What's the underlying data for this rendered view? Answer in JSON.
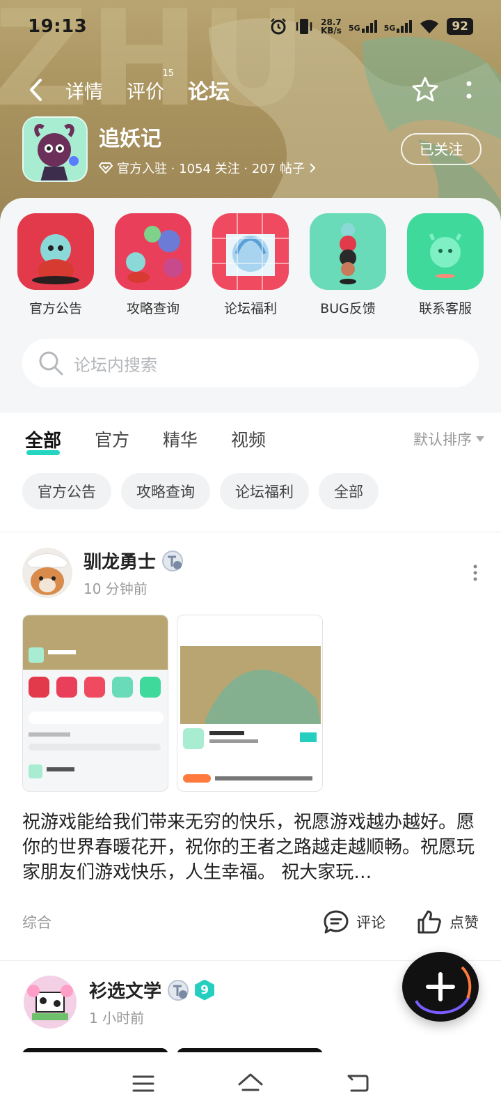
{
  "status_bar": {
    "time": "19:13",
    "speed_value": "28.7",
    "speed_unit": "KB/s",
    "network1": "5G",
    "network2": "5G",
    "battery": "92"
  },
  "nav": {
    "tabs": [
      {
        "label": "详情"
      },
      {
        "label": "评价",
        "badge": "15"
      },
      {
        "label": "论坛"
      }
    ],
    "active_tab": "论坛"
  },
  "game": {
    "name": "追妖记",
    "meta": "官方入驻 · 1054 关注 · 207 帖子",
    "follow_label": "已关注"
  },
  "shortcuts": [
    {
      "label": "官方公告",
      "color": "#e23a4b"
    },
    {
      "label": "攻略查询",
      "color": "#ea3f5a"
    },
    {
      "label": "论坛福利",
      "color": "#ef4a60"
    },
    {
      "label": "BUG反馈",
      "color": "#5fd7b6"
    },
    {
      "label": "联系客服",
      "color": "#3fd99b"
    }
  ],
  "search": {
    "placeholder": "论坛内搜索"
  },
  "filters": {
    "tabs": [
      "全部",
      "官方",
      "精华",
      "视频"
    ],
    "active": "全部",
    "sort_label": "默认排序"
  },
  "chips": [
    "官方公告",
    "攻略查询",
    "论坛福利",
    "全部"
  ],
  "posts": [
    {
      "author": "驯龙勇士",
      "time": "10 分钟前",
      "body": "祝游戏能给我们带来无穷的快乐，祝愿游戏越办越好。愿你的世界春暖花开，祝你的王者之路越走越顺畅。祝愿玩家朋友们游戏快乐，人生幸福。 祝大家玩…",
      "tag": "综合",
      "comment_label": "评论",
      "like_label": "点赞"
    },
    {
      "author": "衫选文学",
      "time": "1 小时前",
      "level": "9"
    }
  ],
  "colors": {
    "accent": "#24d6c2",
    "banner": "#a8925e"
  }
}
